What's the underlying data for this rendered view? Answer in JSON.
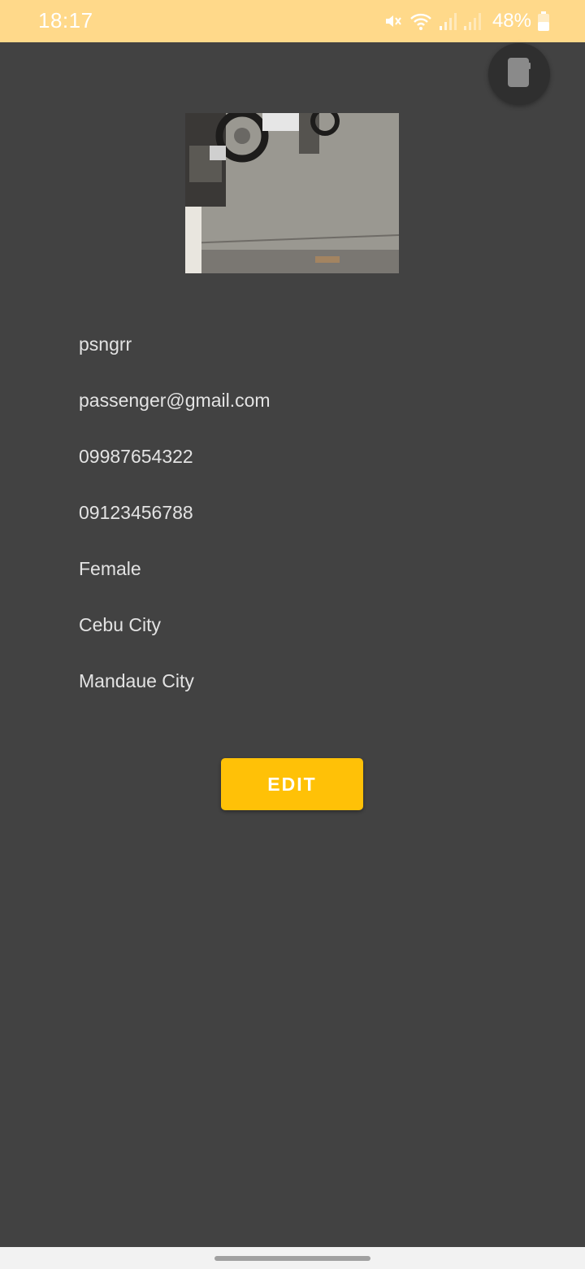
{
  "status_bar": {
    "time": "18:17",
    "battery": "48%",
    "icons": [
      "mute-icon",
      "wifi-icon",
      "signal-icon",
      "signal-icon",
      "battery-icon"
    ]
  },
  "floating_button": {
    "icon": "phone-icon"
  },
  "profile": {
    "username": "psngrr",
    "email": "passenger@gmail.com",
    "phone": "09987654322",
    "emergency_phone": "09123456788",
    "gender": "Female",
    "city": "Cebu City",
    "address": "Mandaue City"
  },
  "actions": {
    "edit_label": "EDIT"
  },
  "colors": {
    "status_bar": "#FFD98A",
    "background": "#424242",
    "accent": "#FFC107",
    "text": "#E3E3E3"
  }
}
